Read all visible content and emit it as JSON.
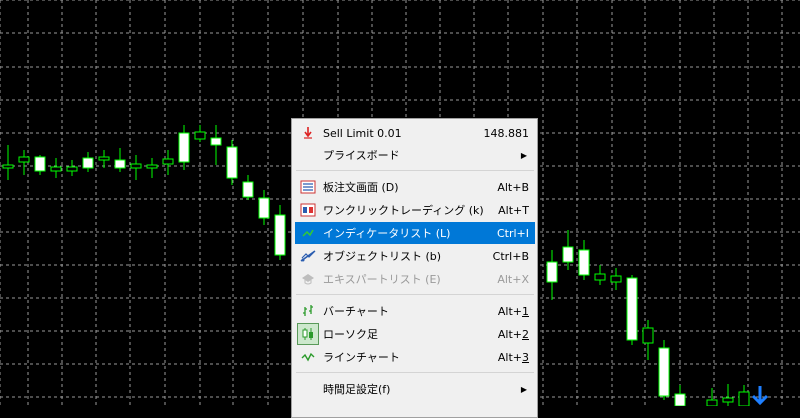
{
  "chart_bg": "#000000",
  "grid_color": "#9a9a9a",
  "candle_color": "#00ff00",
  "candle_body_color": "#ffffff",
  "menu": {
    "items": [
      {
        "label": "Sell Limit 0.01",
        "shortcut": "148.881",
        "icon": "sell-limit-icon"
      },
      {
        "label": "プライスボード",
        "submenu": true
      },
      {
        "label": "板注文画面 (D)",
        "shortcut": "Alt+B",
        "icon": "order-board-icon"
      },
      {
        "label": "ワンクリックトレーディング (k)",
        "shortcut": "Alt+T",
        "icon": "one-click-trading-icon"
      },
      {
        "label": "インディケータリスト (L)",
        "shortcut": "Ctrl+I",
        "icon": "indicator-list-icon",
        "highlighted": true
      },
      {
        "label": "オブジェクトリスト (b)",
        "shortcut": "Ctrl+B",
        "icon": "object-list-icon"
      },
      {
        "label": "エキスパートリスト (E)",
        "shortcut": "Alt+X",
        "icon": "expert-list-icon",
        "disabled": true
      },
      {
        "label": "バーチャート",
        "shortcut_prefix": "Alt+",
        "shortcut_key": "1",
        "icon": "bar-chart-icon"
      },
      {
        "label": "ローソク足",
        "shortcut_prefix": "Alt+",
        "shortcut_key": "2",
        "icon": "candlestick-icon"
      },
      {
        "label": "ラインチャート",
        "shortcut_prefix": "Alt+",
        "shortcut_key": "3",
        "icon": "line-chart-icon"
      },
      {
        "label": "時間足設定(f)",
        "submenu": true
      }
    ],
    "submenu_arrow": "▶"
  },
  "arrow_signal": "down-arrow-icon"
}
